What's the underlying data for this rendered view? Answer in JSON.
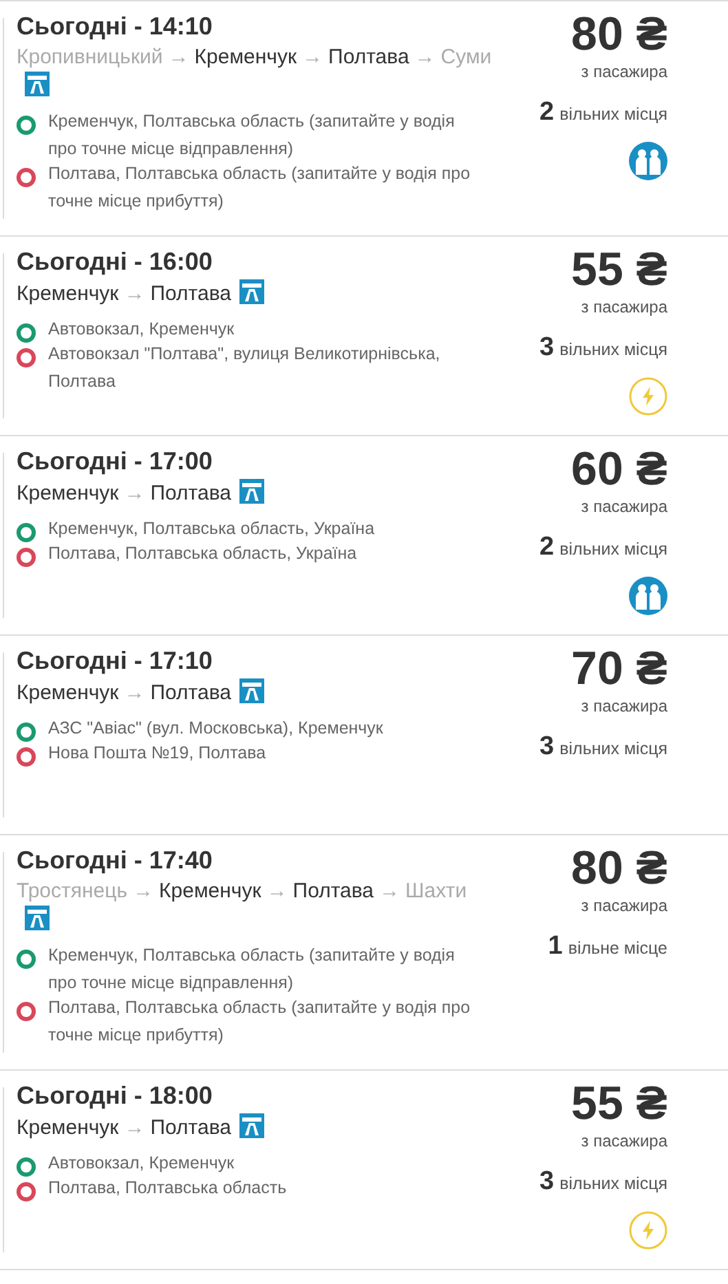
{
  "arrow": "→",
  "trips": [
    {
      "title": "Сьогодні - 14:10",
      "route": [
        {
          "city": "Кропивницький",
          "in_segment": false
        },
        {
          "city": "Кременчук",
          "in_segment": true
        },
        {
          "city": "Полтава",
          "in_segment": true
        },
        {
          "city": "Суми",
          "in_segment": false
        }
      ],
      "price": "80 ₴",
      "price_note": "з пасажира",
      "seats_count": "2",
      "seats_label": "вільних місця",
      "badge": {
        "kind": "comfort"
      },
      "stops": [
        {
          "kind": "departure",
          "text": "Кременчук, Полтавська область (запитайте у водія про точне місце відправлення)"
        },
        {
          "kind": "arrival",
          "text": "Полтава, Полтавська область (запитайте у водія про точне місце прибуття)"
        }
      ]
    },
    {
      "title": "Сьогодні - 16:00",
      "route": [
        {
          "city": "Кременчук",
          "in_segment": true
        },
        {
          "city": "Полтава",
          "in_segment": true
        }
      ],
      "price": "55 ₴",
      "price_note": "з пасажира",
      "seats_count": "3",
      "seats_label": "вільних місця",
      "badge": {
        "kind": "instant"
      },
      "stops": [
        {
          "kind": "departure",
          "text": "Автовокзал, Кременчук"
        },
        {
          "kind": "arrival",
          "text": "Автовокзал \"Полтава\", вулиця Великотирнівська, Полтава"
        }
      ]
    },
    {
      "title": "Сьогодні - 17:00",
      "route": [
        {
          "city": "Кременчук",
          "in_segment": true
        },
        {
          "city": "Полтава",
          "in_segment": true
        }
      ],
      "price": "60 ₴",
      "price_note": "з пасажира",
      "seats_count": "2",
      "seats_label": "вільних місця",
      "badge": {
        "kind": "comfort"
      },
      "stops": [
        {
          "kind": "departure",
          "text": "Кременчук, Полтавська область, Україна"
        },
        {
          "kind": "arrival",
          "text": "Полтава, Полтавська область, Україна"
        }
      ]
    },
    {
      "title": "Сьогодні - 17:10",
      "route": [
        {
          "city": "Кременчук",
          "in_segment": true
        },
        {
          "city": "Полтава",
          "in_segment": true
        }
      ],
      "price": "70 ₴",
      "price_note": "з пасажира",
      "seats_count": "3",
      "seats_label": "вільних місця",
      "stops": [
        {
          "kind": "departure",
          "text": "АЗС \"Авіас\" (вул. Московська), Кременчук"
        },
        {
          "kind": "arrival",
          "text": "Нова Пошта №19, Полтава"
        }
      ]
    },
    {
      "title": "Сьогодні - 17:40",
      "route": [
        {
          "city": "Тростянець",
          "in_segment": false
        },
        {
          "city": "Кременчук",
          "in_segment": true
        },
        {
          "city": "Полтава",
          "in_segment": true
        },
        {
          "city": "Шахти",
          "in_segment": false
        }
      ],
      "price": "80 ₴",
      "price_note": "з пасажира",
      "seats_count": "1",
      "seats_label": "вільне місце",
      "stops": [
        {
          "kind": "departure",
          "text": "Кременчук, Полтавська область (запитайте у водія про точне місце відправлення)"
        },
        {
          "kind": "arrival",
          "text": "Полтава, Полтавська область (запитайте у водія про точне місце прибуття)"
        }
      ]
    },
    {
      "title": "Сьогодні - 18:00",
      "route": [
        {
          "city": "Кременчук",
          "in_segment": true
        },
        {
          "city": "Полтава",
          "in_segment": true
        }
      ],
      "price": "55 ₴",
      "price_note": "з пасажира",
      "seats_count": "3",
      "seats_label": "вільних місця",
      "badge": {
        "kind": "instant"
      },
      "stops": [
        {
          "kind": "departure",
          "text": "Автовокзал, Кременчук"
        },
        {
          "kind": "arrival",
          "text": "Полтава, Полтавська область"
        }
      ]
    }
  ]
}
